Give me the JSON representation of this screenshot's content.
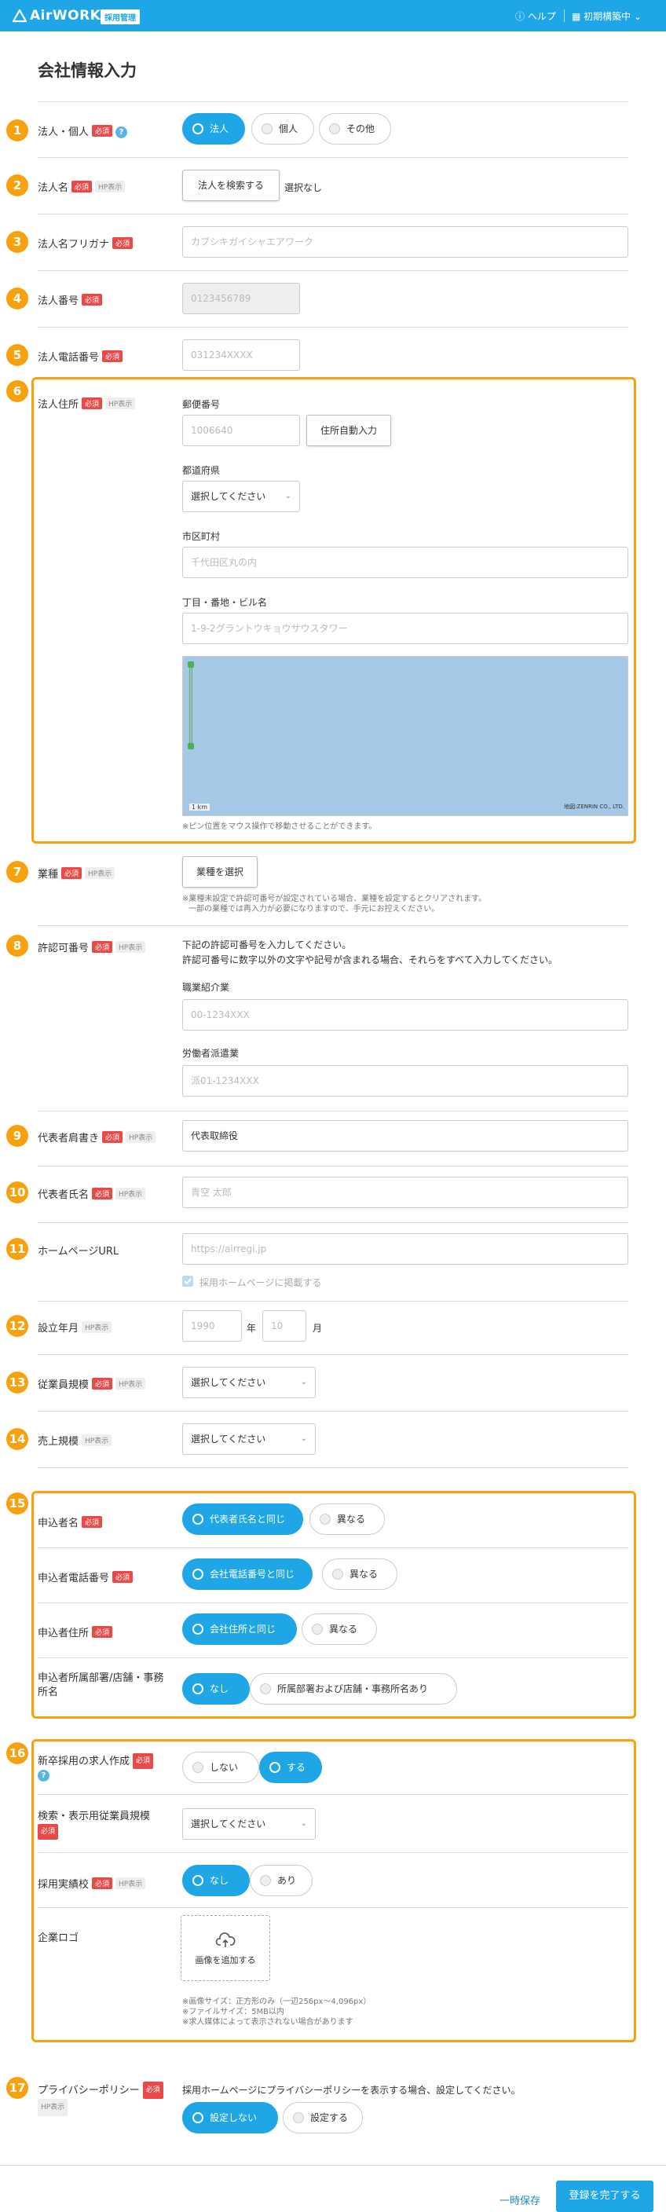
{
  "header": {
    "logo": "AirWORK",
    "logo_badge": "採用管理",
    "help": "ヘルプ",
    "user": "初期構築中"
  },
  "page_title": "会社情報入力",
  "badges": {
    "required": "必須",
    "hp": "HP表示"
  },
  "s1": {
    "num": "1",
    "label": "法人・個人",
    "options": [
      "法人",
      "個人",
      "その他"
    ],
    "selected": "法人"
  },
  "s2": {
    "num": "2",
    "label": "法人名",
    "button": "法人を検索する",
    "status": "選択なし"
  },
  "s3": {
    "num": "3",
    "label": "法人名フリガナ",
    "placeholder": "カブシキガイシャエアワーク"
  },
  "s4": {
    "num": "4",
    "label": "法人番号",
    "placeholder": "0123456789"
  },
  "s5": {
    "num": "5",
    "label": "法人電話番号",
    "placeholder": "031234XXXX"
  },
  "s6": {
    "num": "6",
    "label": "法人住所",
    "postal_label": "郵便番号",
    "postal_placeholder": "1006640",
    "auto_button": "住所自動入力",
    "pref_label": "都道府県",
    "pref_value": "選択してください",
    "city_label": "市区町村",
    "city_placeholder": "千代田区丸の内",
    "street_label": "丁目・番地・ビル名",
    "street_placeholder": "1-9-2グラントウキョウサウスタワー",
    "map_scale": "1 km",
    "map_credit": "地図:ZENRIN CO., LTD.",
    "map_note": "※ピン位置をマウス操作で移動させることができます。"
  },
  "s7": {
    "num": "7",
    "label": "業種",
    "button": "業種を選択",
    "note1": "※業種未設定で許認可番号が設定されている場合、業種を設定するとクリアされます。",
    "note2": "一部の業種では再入力が必要になりますので、手元にお控えください。"
  },
  "s8": {
    "num": "8",
    "label": "許認可番号",
    "desc1": "下記の許認可番号を入力してください。",
    "desc2": "許認可番号に数字以外の文字や記号が含まれる場合、それらをすべて入力してください。",
    "a_label": "職業紹介業",
    "a_placeholder": "00-1234XXX",
    "b_label": "労働者派遣業",
    "b_placeholder": "派01-1234XXX"
  },
  "s9": {
    "num": "9",
    "label": "代表者肩書き",
    "value": "代表取締役"
  },
  "s10": {
    "num": "10",
    "label": "代表者氏名",
    "placeholder": "青空 太郎"
  },
  "s11": {
    "num": "11",
    "label": "ホームページURL",
    "placeholder": "https://airregi.jp",
    "checkbox": "採用ホームページに掲載する"
  },
  "s12": {
    "num": "12",
    "label": "設立年月",
    "year_placeholder": "1990",
    "year_unit": "年",
    "month_placeholder": "10",
    "month_unit": "月"
  },
  "s13": {
    "num": "13",
    "label": "従業員規模",
    "value": "選択してください"
  },
  "s14": {
    "num": "14",
    "label": "売上規模",
    "value": "選択してください"
  },
  "s15": {
    "num": "15",
    "rows": [
      {
        "label": "申込者名",
        "options": [
          "代表者氏名と同じ",
          "異なる"
        ]
      },
      {
        "label": "申込者電話番号",
        "options": [
          "会社電話番号と同じ",
          "異なる"
        ]
      },
      {
        "label": "申込者住所",
        "options": [
          "会社住所と同じ",
          "異なる"
        ]
      },
      {
        "label_line1": "申込者所属部署/店舗・事務",
        "label_line2": "所名",
        "options": [
          "なし",
          "所属部署および店舗・事務所名あり"
        ]
      }
    ]
  },
  "s16": {
    "num": "16",
    "newgrad_label": "新卒採用の求人作成",
    "newgrad_options": [
      "しない",
      "する"
    ],
    "scale_label": "検索・表示用従業員規模",
    "scale_value": "選択してください",
    "record_label": "採用実績校",
    "record_options": [
      "なし",
      "あり"
    ],
    "logo_label": "企業ロゴ",
    "upload_label": "画像を追加する",
    "note1": "※画像サイズ：正方形のみ（一辺256px〜4,096px）",
    "note2": "※ファイルサイズ：5MB以内",
    "note3": "※求人媒体によって表示されない場合があります"
  },
  "s17": {
    "num": "17",
    "label": "プライバシーポリシー",
    "desc": "採用ホームページにプライバシーポリシーを表示する場合、設定してください。",
    "options": [
      "設定しない",
      "設定する"
    ]
  },
  "footer": {
    "save": "一時保存",
    "complete": "登録を完了する"
  },
  "colors": {
    "accent": "#1ea6e6",
    "highlight": "#f7a10f",
    "required": "#e84a4a"
  }
}
